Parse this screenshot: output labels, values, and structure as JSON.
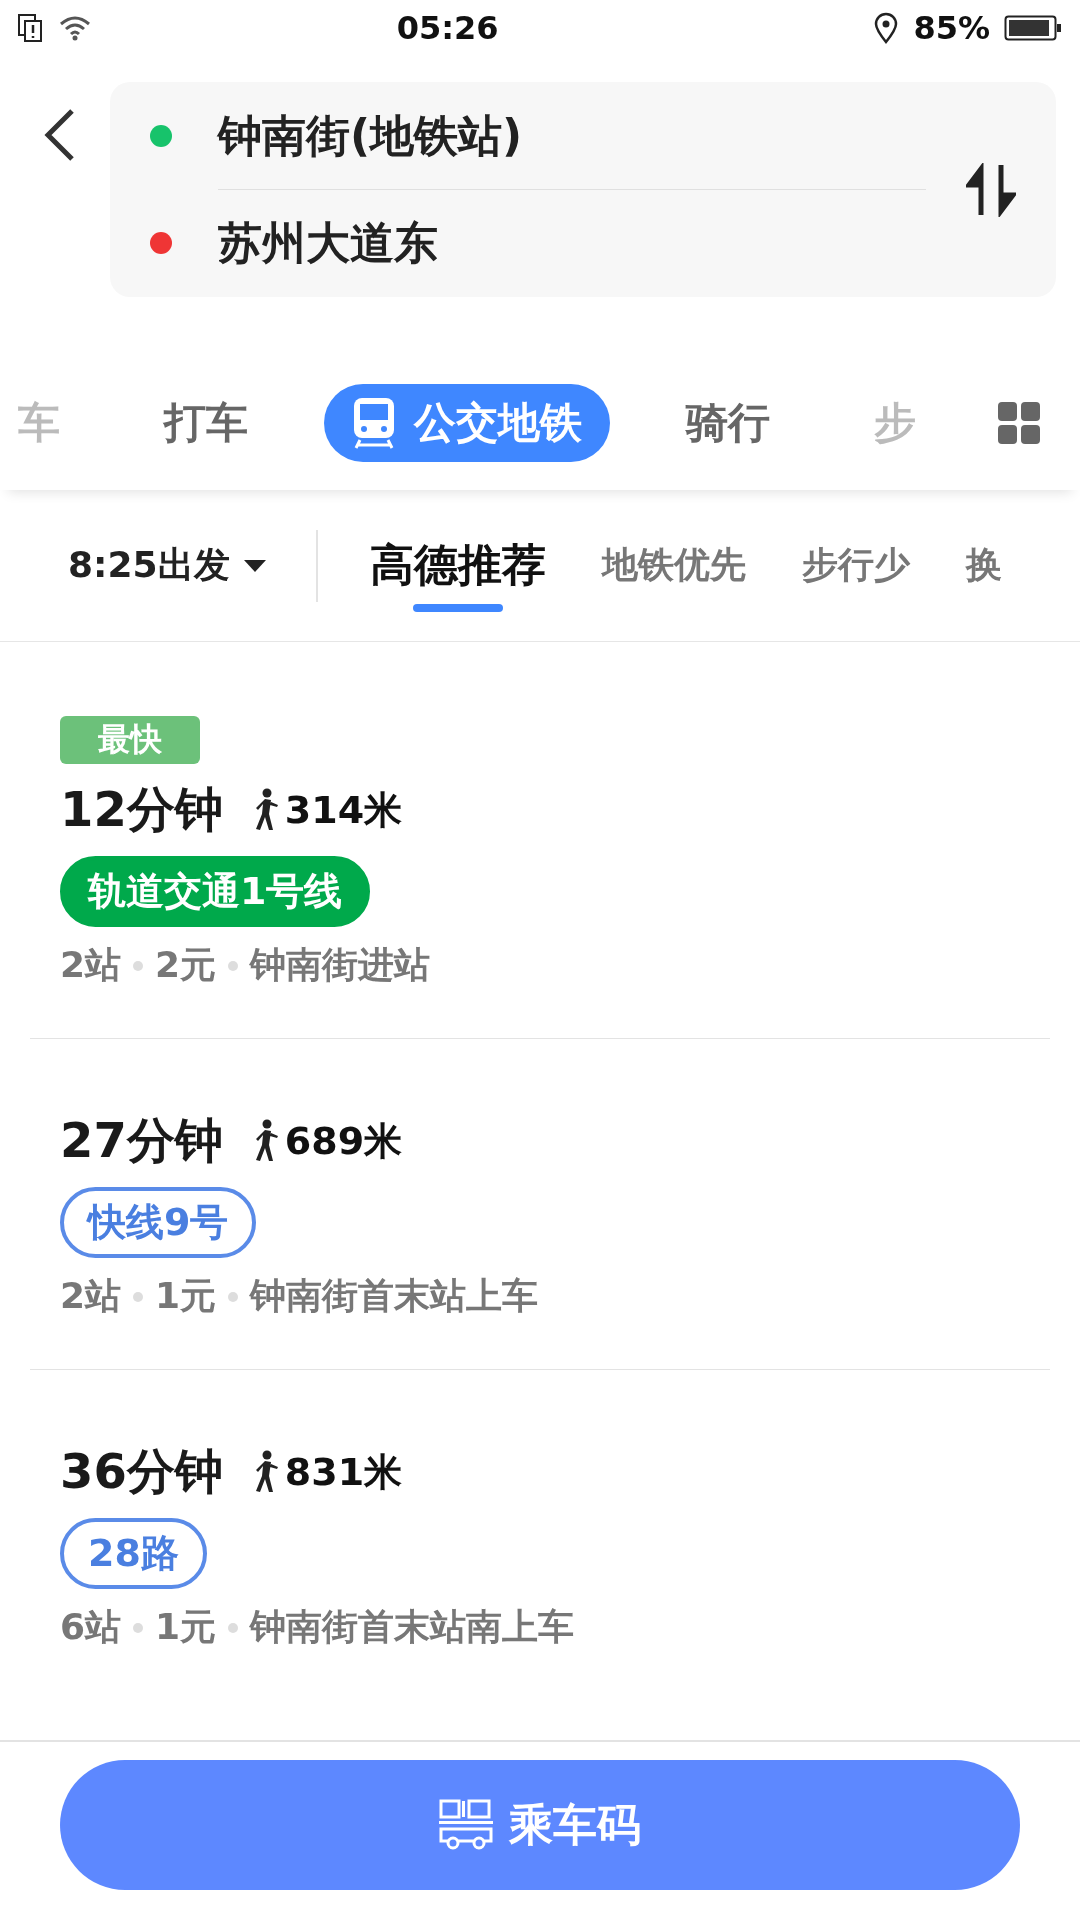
{
  "status_bar": {
    "time": "05:26",
    "battery": "85%"
  },
  "route": {
    "origin": "钟南街(地铁站)",
    "destination": "苏州大道东"
  },
  "modes": [
    {
      "label": "车",
      "selected": false,
      "faded": true
    },
    {
      "label": "打车",
      "selected": false,
      "faded": false
    },
    {
      "label": "公交地铁",
      "selected": true,
      "faded": false
    },
    {
      "label": "骑行",
      "selected": false,
      "faded": false
    },
    {
      "label": "步",
      "selected": false,
      "faded": true
    }
  ],
  "departure": "8:25出发",
  "sort_tabs": [
    {
      "label": "高德推荐",
      "selected": true
    },
    {
      "label": "地铁优先",
      "selected": false
    },
    {
      "label": "步行少",
      "selected": false
    },
    {
      "label": "换",
      "selected": false
    }
  ],
  "routes": [
    {
      "tag": "最快",
      "duration": "12分钟",
      "walk": "314米",
      "line": {
        "kind": "rail",
        "name": "轨道交通1号线"
      },
      "meta": [
        "2站",
        "2元",
        "钟南街进站"
      ]
    },
    {
      "duration": "27分钟",
      "walk": "689米",
      "line": {
        "kind": "bus",
        "name": "快线9号"
      },
      "meta": [
        "2站",
        "1元",
        "钟南街首末站上车"
      ]
    },
    {
      "duration": "36分钟",
      "walk": "831米",
      "line": {
        "kind": "bus",
        "name": "28路"
      },
      "meta": [
        "6站",
        "1元",
        "钟南街首末站南上车"
      ]
    }
  ],
  "ride_button": "乘车码"
}
